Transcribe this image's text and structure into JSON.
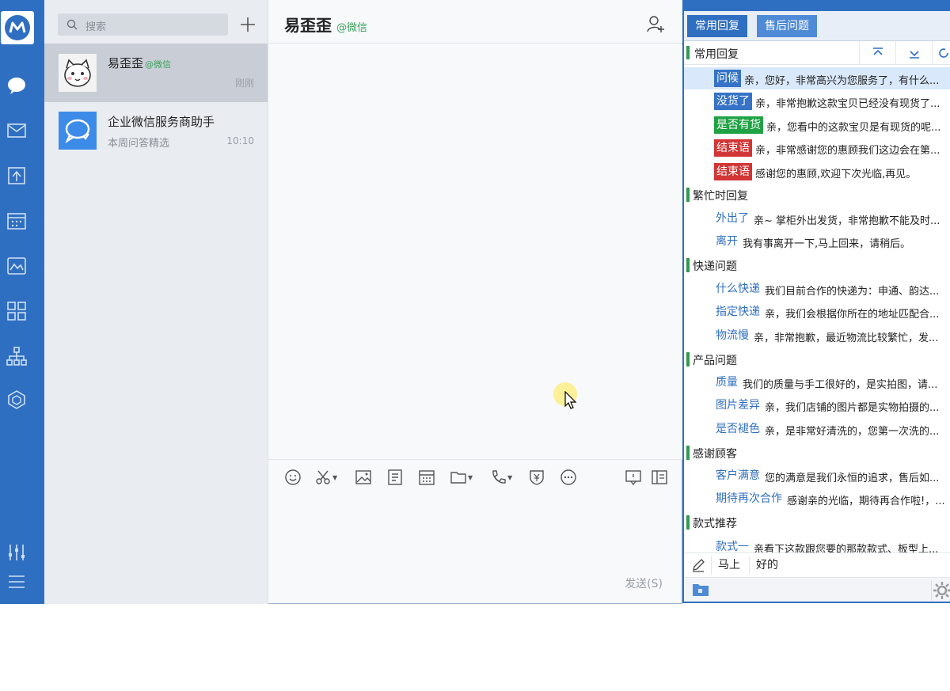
{
  "colors": {
    "brand": "#2f6fc2",
    "accent_green": "#1fa244",
    "accent_red": "#d23535",
    "source_green": "#3aa15a"
  },
  "rail": {
    "icons": [
      "logo-icon",
      "chat-icon",
      "mail-icon",
      "docs-icon",
      "calendar-icon",
      "workspace-icon",
      "apps-icon",
      "org-icon",
      "box-icon",
      "settings-sliders-icon",
      "menu-icon"
    ]
  },
  "contacts": {
    "search_placeholder": "搜索",
    "conversations": [
      {
        "name": "易歪歪",
        "tag": "@微信",
        "time": "刚刚",
        "sub": ""
      },
      {
        "name": "企业微信服务商助手",
        "tag": "",
        "time": "10:10",
        "sub": "本周问答精选"
      }
    ]
  },
  "chat": {
    "title": "易歪歪",
    "source": "@微信",
    "send_label": "发送(S)"
  },
  "quick_reply": {
    "tabs": [
      "常用回复",
      "售后问题"
    ],
    "current_group": "常用回复",
    "categories": [
      {
        "name": "常用回复",
        "items": [
          {
            "key": "问候",
            "style": "blue-bg",
            "text": "亲，您好，非常高兴为您服务了，有什么..."
          },
          {
            "key": "没货了",
            "style": "blue-bg",
            "text": "亲，非常抱歉这款宝贝已经没有现货了..."
          },
          {
            "key": "是否有货",
            "style": "green-bg",
            "text": "亲，您看中的这款宝贝是有现货的呢..."
          },
          {
            "key": "结束语",
            "style": "red-bg",
            "text": "亲，非常感谢您的惠顾我们这边会在第..."
          },
          {
            "key": "结束语",
            "style": "red-bg",
            "text": "感谢您的惠顾,欢迎下次光临,再见。"
          }
        ]
      },
      {
        "name": "繁忙时回复",
        "items": [
          {
            "key": "外出了",
            "style": "plain",
            "text": "亲~ 掌柜外出发货，非常抱歉不能及时..."
          },
          {
            "key": "离开",
            "style": "plain",
            "text": "我有事离开一下,马上回来，请稍后。"
          }
        ]
      },
      {
        "name": "快递问题",
        "items": [
          {
            "key": "什么快递",
            "style": "plain",
            "text": "我们目前合作的快递为：申通、韵达..."
          },
          {
            "key": "指定快递",
            "style": "plain",
            "text": "亲，我们会根据你所在的地址匹配合..."
          },
          {
            "key": "物流慢",
            "style": "plain",
            "text": "亲，非常抱歉，最近物流比较繁忙，发..."
          }
        ]
      },
      {
        "name": "产品问题",
        "items": [
          {
            "key": "质量",
            "style": "plain",
            "text": "我们的质量与手工很好的，是实拍图，请..."
          },
          {
            "key": "图片差异",
            "style": "plain",
            "text": "亲，我们店铺的图片都是实物拍摄的..."
          },
          {
            "key": "是否褪色",
            "style": "plain",
            "text": "亲，是非常好清洗的，您第一次洗的..."
          }
        ]
      },
      {
        "name": "感谢顾客",
        "items": [
          {
            "key": "客户满意",
            "style": "plain",
            "text": "您的满意是我们永恒的追求，售后如..."
          },
          {
            "key": "期待再次合作",
            "style": "plain",
            "text": "感谢亲的光临，期待再合作啦!，..."
          }
        ]
      },
      {
        "name": "款式推荐",
        "items": [
          {
            "key": "款式一",
            "style": "plain",
            "text": "亲看下这款跟您要的那款款式、板型上..."
          }
        ]
      }
    ],
    "quick_words": [
      "马上",
      "好的"
    ]
  }
}
